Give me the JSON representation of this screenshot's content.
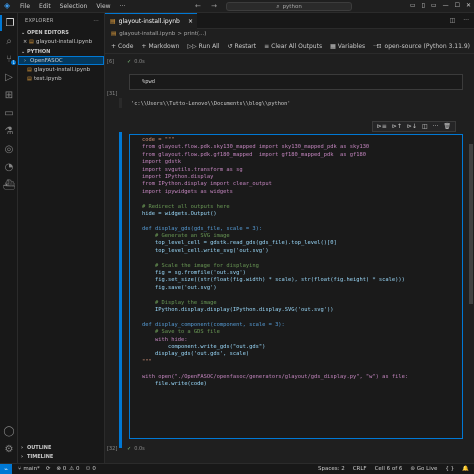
{
  "titlebar": {
    "menu": [
      "File",
      "Edit",
      "Selection",
      "View",
      "···"
    ],
    "nav": "← →",
    "search": "python",
    "window_controls": [
      "▭",
      "▯",
      "▭",
      "—",
      "☐",
      "✕"
    ]
  },
  "sidebar": {
    "title": "EXPLORER",
    "more": "···",
    "open_editors_label": "OPEN EDITORS",
    "open_editors": [
      {
        "name": "glayout-install.ipynb"
      }
    ],
    "python_label": "PYTHON",
    "tree": [
      {
        "name": "OpenFASOC",
        "kind": "folder"
      },
      {
        "name": "glayout-install.ipynb",
        "kind": "notebook"
      },
      {
        "name": "test.ipynb",
        "kind": "notebook"
      }
    ],
    "outline_label": "OUTLINE",
    "timeline_label": "TIMELINE"
  },
  "activity": {
    "badge": "1",
    "icons": [
      "files-icon",
      "search-icon",
      "source-control-icon",
      "run-debug-icon",
      "extensions-icon",
      "remote-explorer-icon",
      "testing-icon",
      "jupyter-icon",
      "edge-icon",
      "docker-icon"
    ]
  },
  "tab": {
    "label": "glayout-install.ipynb",
    "close": "×"
  },
  "breadcrumb": {
    "file": "glayout-install.ipynb",
    "sep": ">",
    "rest": "print(...)"
  },
  "toolbar": {
    "code": "Code",
    "markdown": "Markdown",
    "run_all": "Run All",
    "restart": "Restart",
    "clear_outputs": "Clear All Outputs",
    "variables": "Variables",
    "more": "···",
    "kernel": "open-source (Python 3.11.9)"
  },
  "cells": {
    "cell1": {
      "exec": "[6]",
      "status": "0.0s"
    },
    "pwd_cell": {
      "exec": "[31]",
      "code": "%pwd"
    },
    "pwd_output": "'c:\\\\Users\\\\Tutto-Lenovo\\\\Documents\\\\blog\\\\python'",
    "main_cell": {
      "exec": "[32]",
      "status": "0.0s"
    }
  },
  "code_lines": [
    "code = \"\"\"",
    "from glayout.flow.pdk.sky130_mapped import sky130_mapped_pdk as sky130",
    "from glayout.flow.pdk.gf180_mapped  import gf180_mapped_pdk  as gf180",
    "import gdstk",
    "import svgutils.transform as sg",
    "import IPython.display",
    "from IPython.display import clear_output",
    "import ipywidgets as widgets",
    "",
    "# Redirect all outputs here",
    "hide = widgets.Output()",
    "",
    "def display_gds(gds_file, scale = 3):",
    "    # Generate an SVG image",
    "    top_level_cell = gdstk.read_gds(gds_file).top_level()[0]",
    "    top_level_cell.write_svg('out.svg')",
    "",
    "    # Scale the image for displaying",
    "    fig = sg.fromfile('out.svg')",
    "    fig.set_size((str(float(fig.width) * scale), str(float(fig.height) * scale)))",
    "    fig.save('out.svg')",
    "",
    "    # Display the image",
    "    IPython.display.display(IPython.display.SVG('out.svg'))",
    "",
    "def display_component(component, scale = 3):",
    "    # Save to a GDS file",
    "    with hide:",
    "        component.write_gds(\"out.gds\")",
    "    display_gds('out.gds', scale)",
    "\"\"\"",
    "",
    "with open(\"./OpenFASOC/openfasoc/generators/glayout/gds_display.py\", \"w\") as file:",
    "    file.write(code)"
  ],
  "statusbar": {
    "branch": "main*",
    "sync": "⟳",
    "errors": "⊗ 0",
    "warnings": "⚠ 0",
    "ports": "0",
    "spaces": "Spaces: 2",
    "eol": "CRLF",
    "cell": "Cell 6 of 6",
    "golive": "Go Live",
    "jupyter": "{ }"
  },
  "colors": {
    "accent": "#0078d4",
    "editor_bg": "#1f1f1f",
    "sidebar_bg": "#181818"
  }
}
